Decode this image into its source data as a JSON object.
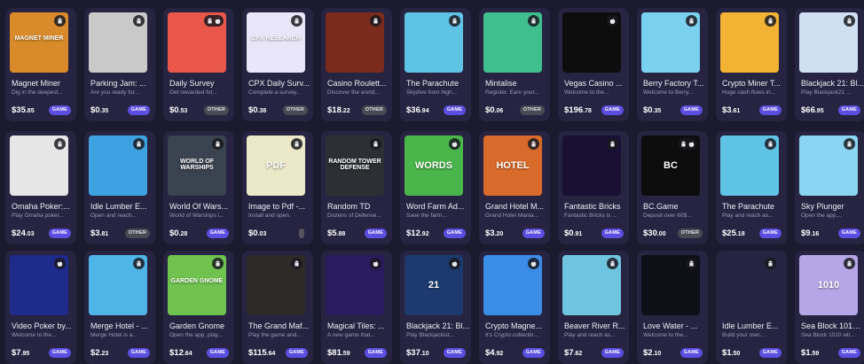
{
  "cards": [
    {
      "title": "Magnet Miner",
      "desc": "Dig in the deepest...",
      "price_main": "$35",
      "price_cents": ".85",
      "tag": "GAME",
      "os": [
        "android"
      ],
      "thumb_bg": "#d98a2a",
      "thumb_text": "MAGNET MINER"
    },
    {
      "title": "Parking Jam: ...",
      "desc": "Are you ready for...",
      "price_main": "$0",
      "price_cents": ".35",
      "tag": "GAME",
      "os": [
        "android"
      ],
      "thumb_bg": "#c9c9c9",
      "thumb_text": ""
    },
    {
      "title": "Daily Survey",
      "desc": "Get rewarded for...",
      "price_main": "$0",
      "price_cents": ".53",
      "tag": "OTHER",
      "os": [
        "android",
        "apple"
      ],
      "thumb_bg": "#e9574a",
      "thumb_text": ""
    },
    {
      "title": "CPX Daily Surv...",
      "desc": "Complete a survey...",
      "price_main": "$0",
      "price_cents": ".38",
      "tag": "OTHER",
      "os": [
        "android"
      ],
      "thumb_bg": "#e8e6f8",
      "thumb_text": "CPX RESEARCH"
    },
    {
      "title": "Casino Roulett...",
      "desc": "Discover the world...",
      "price_main": "$18",
      "price_cents": ".22",
      "tag": "OTHER",
      "os": [
        "android"
      ],
      "thumb_bg": "#7a2b1c",
      "thumb_text": ""
    },
    {
      "title": "The Parachute",
      "desc": "Skydive from high...",
      "price_main": "$36",
      "price_cents": ".94",
      "tag": "GAME",
      "os": [
        "android"
      ],
      "thumb_bg": "#5fc3e6",
      "thumb_text": ""
    },
    {
      "title": "Mintalise",
      "desc": "Register. Earn your...",
      "price_main": "$0",
      "price_cents": ".06",
      "tag": "OTHER",
      "os": [
        "android"
      ],
      "thumb_bg": "#3fbf8e",
      "thumb_text": ""
    },
    {
      "title": "Vegas Casino ...",
      "desc": "Welcome to the...",
      "price_main": "$196",
      "price_cents": ".78",
      "tag": "GAME",
      "os": [
        "apple"
      ],
      "thumb_bg": "#0d0d0d",
      "thumb_text": ""
    },
    {
      "title": "Berry Factory T...",
      "desc": "Welcome to Berry...",
      "price_main": "$0",
      "price_cents": ".35",
      "tag": "GAME",
      "os": [
        "android"
      ],
      "thumb_bg": "#7ad0ef",
      "thumb_text": ""
    },
    {
      "title": "Crypto Miner T...",
      "desc": "Huge cash flows in...",
      "price_main": "$3",
      "price_cents": ".61",
      "tag": "GAME",
      "os": [
        "android"
      ],
      "thumb_bg": "#f2b233",
      "thumb_text": ""
    },
    {
      "title": "Blackjack 21: Bl...",
      "desc": "Play Blackjack21 ...",
      "price_main": "$66",
      "price_cents": ".95",
      "tag": "GAME",
      "os": [
        "android"
      ],
      "thumb_bg": "#cfe0f2",
      "thumb_text": ""
    },
    {
      "title": "Omaha Poker:...",
      "desc": "Play Omaha poker...",
      "price_main": "$24",
      "price_cents": ".03",
      "tag": "GAME",
      "os": [
        "android"
      ],
      "thumb_bg": "#e6e6e6",
      "thumb_text": ""
    },
    {
      "title": "Idle Lumber E...",
      "desc": "Open and reach...",
      "price_main": "$3",
      "price_cents": ".81",
      "tag": "OTHER",
      "os": [
        "android"
      ],
      "thumb_bg": "#3ea2e0",
      "thumb_text": ""
    },
    {
      "title": "World Of Wars...",
      "desc": "World of Warships i...",
      "price_main": "$0",
      "price_cents": ".28",
      "tag": "GAME",
      "os": [
        "android"
      ],
      "thumb_bg": "#3a4350",
      "thumb_text": "WORLD OF WARSHIPS"
    },
    {
      "title": "Image to Pdf -...",
      "desc": "Install and open.",
      "price_main": "$0",
      "price_cents": ".03",
      "tag": "",
      "os": [
        "android"
      ],
      "thumb_bg": "#ece9c9",
      "thumb_text": "PDF"
    },
    {
      "title": "Random TD",
      "desc": "Dozens of Defense...",
      "price_main": "$5",
      "price_cents": ".88",
      "tag": "GAME",
      "os": [
        "android"
      ],
      "thumb_bg": "#2c2f33",
      "thumb_text": "RANDOM TOWER DEFENSE"
    },
    {
      "title": "Word Farm Ad...",
      "desc": "Save the farm...",
      "price_main": "$12",
      "price_cents": ".92",
      "tag": "GAME",
      "os": [
        "apple"
      ],
      "thumb_bg": "#49b54a",
      "thumb_text": "WORDS"
    },
    {
      "title": "Grand Hotel M...",
      "desc": "Grand Hotel Mania...",
      "price_main": "$3",
      "price_cents": ".20",
      "tag": "GAME",
      "os": [
        "android"
      ],
      "thumb_bg": "#d96b2a",
      "thumb_text": "HOTEL"
    },
    {
      "title": "Fantastic Bricks",
      "desc": "Fantastic Bricks is ...",
      "price_main": "$0",
      "price_cents": ".91",
      "tag": "GAME",
      "os": [
        "android"
      ],
      "thumb_bg": "#1a1033",
      "thumb_text": ""
    },
    {
      "title": "BC.Game",
      "desc": "Deposit over 60$...",
      "price_main": "$30",
      "price_cents": ".00",
      "tag": "OTHER",
      "os": [
        "android",
        "apple"
      ],
      "thumb_bg": "#0d0d0d",
      "thumb_text": "BC"
    },
    {
      "title": "The Parachute",
      "desc": "Play and reach as...",
      "price_main": "$25",
      "price_cents": ".18",
      "tag": "GAME",
      "os": [
        "android"
      ],
      "thumb_bg": "#5fc3e6",
      "thumb_text": ""
    },
    {
      "title": "Sky Plunger",
      "desc": "Open the app,...",
      "price_main": "$9",
      "price_cents": ".16",
      "tag": "GAME",
      "os": [
        "android"
      ],
      "thumb_bg": "#8ad6f2",
      "thumb_text": ""
    },
    {
      "title": "Video Poker by...",
      "desc": "Welcome to the...",
      "price_main": "$7",
      "price_cents": ".95",
      "tag": "GAME",
      "os": [
        "apple"
      ],
      "thumb_bg": "#1e2a8c",
      "thumb_text": ""
    },
    {
      "title": "Merge Hotel - ...",
      "desc": "Merge Hotel is a...",
      "price_main": "$2",
      "price_cents": ".23",
      "tag": "GAME",
      "os": [
        "android"
      ],
      "thumb_bg": "#4fb5e8",
      "thumb_text": ""
    },
    {
      "title": "Garden Gnome",
      "desc": "Open the app, play...",
      "price_main": "$12",
      "price_cents": ".64",
      "tag": "GAME",
      "os": [
        "android"
      ],
      "thumb_bg": "#6fc24e",
      "thumb_text": "GARDEN GNOME"
    },
    {
      "title": "The Grand Maf...",
      "desc": "Play the game and...",
      "price_main": "$115",
      "price_cents": ".64",
      "tag": "GAME",
      "os": [
        "android"
      ],
      "thumb_bg": "#2e2a28",
      "thumb_text": ""
    },
    {
      "title": "Magical Tiles: ...",
      "desc": "A new game that...",
      "price_main": "$81",
      "price_cents": ".59",
      "tag": "GAME",
      "os": [
        "apple"
      ],
      "thumb_bg": "#2a1a5e",
      "thumb_text": ""
    },
    {
      "title": "Blackjack 21: Bl...",
      "desc": "Play Blackjackist...",
      "price_main": "$37",
      "price_cents": ".10",
      "tag": "GAME",
      "os": [
        "apple"
      ],
      "thumb_bg": "#1c3a6e",
      "thumb_text": "21"
    },
    {
      "title": "Crypto Magne...",
      "desc": "It's Crypto collectin...",
      "price_main": "$4",
      "price_cents": ".92",
      "tag": "GAME",
      "os": [
        "apple"
      ],
      "thumb_bg": "#3b8de8",
      "thumb_text": ""
    },
    {
      "title": "Beaver River R...",
      "desc": "Play and reach as...",
      "price_main": "$7",
      "price_cents": ".62",
      "tag": "GAME",
      "os": [
        "android"
      ],
      "thumb_bg": "#6fc4e0",
      "thumb_text": ""
    },
    {
      "title": "Love Water - ...",
      "desc": "Welcome to the...",
      "price_main": "$2",
      "price_cents": ".10",
      "tag": "GAME",
      "os": [
        "android"
      ],
      "thumb_bg": "#0f0f18",
      "thumb_text": ""
    },
    {
      "title": "Idle Lumber E...",
      "desc": "Build your own...",
      "price_main": "$1",
      "price_cents": ".50",
      "tag": "GAME",
      "os": [
        "android"
      ],
      "thumb_bg": "#262440",
      "thumb_text": ""
    },
    {
      "title": "Sea Block 1010 ...",
      "desc": "Sea Block 1010 wil...",
      "price_main": "$1",
      "price_cents": ".59",
      "tag": "GAME",
      "os": [
        "android"
      ],
      "thumb_bg": "#b6a6e8",
      "thumb_text": "1010"
    }
  ]
}
